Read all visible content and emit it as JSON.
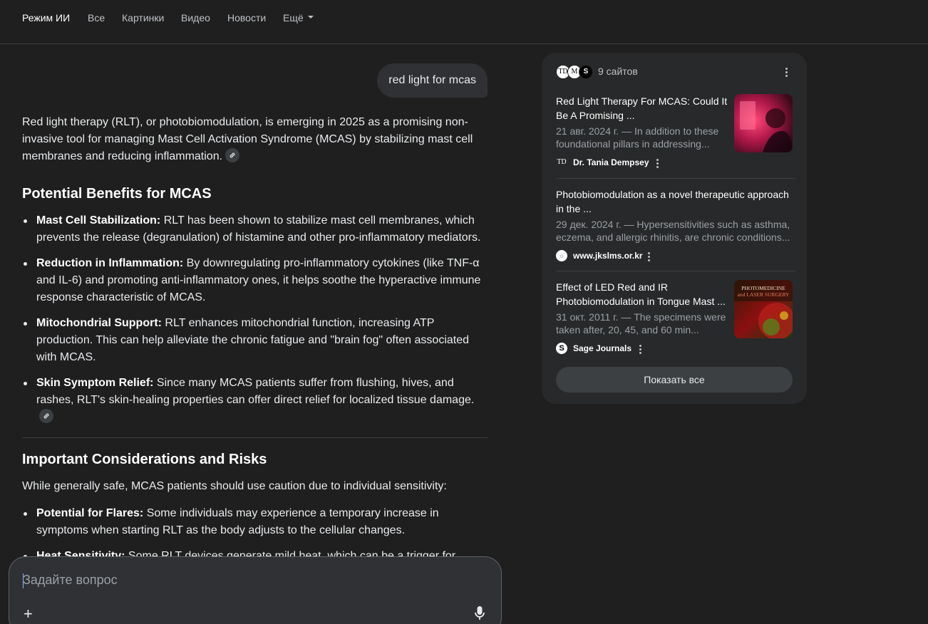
{
  "nav": {
    "tabs": [
      {
        "label": "Режим ИИ",
        "active": true
      },
      {
        "label": "Все"
      },
      {
        "label": "Картинки"
      },
      {
        "label": "Видео"
      },
      {
        "label": "Новости"
      },
      {
        "label": "Ещё"
      }
    ]
  },
  "conversation": {
    "user_query": "red light for mcas",
    "intro": "Red light therapy (RLT), or photobiomodulation, is emerging in 2025 as a promising non-invasive tool for managing Mast Cell Activation Syndrome (MCAS) by stabilizing mast cell membranes and reducing inflammation.",
    "section1": {
      "heading": "Potential Benefits for MCAS",
      "items": [
        {
          "term": "Mast Cell Stabilization:",
          "text": " RLT has been shown to stabilize mast cell membranes, which prevents the release (degranulation) of histamine and other pro-inflammatory mediators."
        },
        {
          "term": "Reduction in Inflammation:",
          "text": " By downregulating pro-inflammatory cytokines (like TNF-α and IL-6) and promoting anti-inflammatory ones, it helps soothe the hyperactive immune response characteristic of MCAS."
        },
        {
          "term": "Mitochondrial Support:",
          "text": " RLT enhances mitochondrial function, increasing ATP production. This can help alleviate the chronic fatigue and \"brain fog\" often associated with MCAS."
        },
        {
          "term": "Skin Symptom Relief:",
          "text": " Since many MCAS patients suffer from flushing, hives, and rashes, RLT's skin-healing properties can offer direct relief for localized tissue damage."
        }
      ]
    },
    "section2": {
      "heading": "Important Considerations and Risks",
      "intro": "While generally safe, MCAS patients should use caution due to individual sensitivity:",
      "items": [
        {
          "term": "Potential for Flares:",
          "text": " Some individuals may experience a temporary increase in symptoms when starting RLT as the body adjusts to the cellular changes."
        },
        {
          "term": "Heat Sensitivity:",
          "text": " Some RLT devices generate mild heat, which can be a trigger for"
        }
      ]
    }
  },
  "composer": {
    "placeholder": "Задайте вопрос",
    "plus_label": "+"
  },
  "sources": {
    "count_label": "9 сайтов",
    "header_favicons": [
      "TD",
      "M",
      "S"
    ],
    "cards": [
      {
        "title": "Red Light Therapy For MCAS: Could It Be A Promising ...",
        "snippet": "21 авг. 2024 г. — In addition to these foundational pillars in addressing...",
        "site": "Dr. Tania Dempsey",
        "favicon": "TD"
      },
      {
        "title": "Photobiomodulation as a novel therapeutic approach in the ...",
        "snippet": "29 дек. 2024 г. — Hypersensitivities such as asthma, eczema, and allergic rhinitis, are chronic conditions...",
        "site": "www.jkslms.or.kr",
        "favicon": "○"
      },
      {
        "title": "Effect of LED Red and IR Photobiomodulation in Tongue Mast ...",
        "snippet": "31 окт. 2011 г. — The specimens were taken after, 20, 45, and 60 min...",
        "site": "Sage Journals",
        "favicon": "S",
        "thumb_line1": "PHOTOMEDICINE",
        "thumb_line2": "and LASER SURGERY"
      }
    ],
    "show_all_label": "Показать все"
  },
  "colors": {
    "background": "#1f1f1f",
    "panel": "#28292a",
    "accent_cursor": "#8ab4f8"
  }
}
